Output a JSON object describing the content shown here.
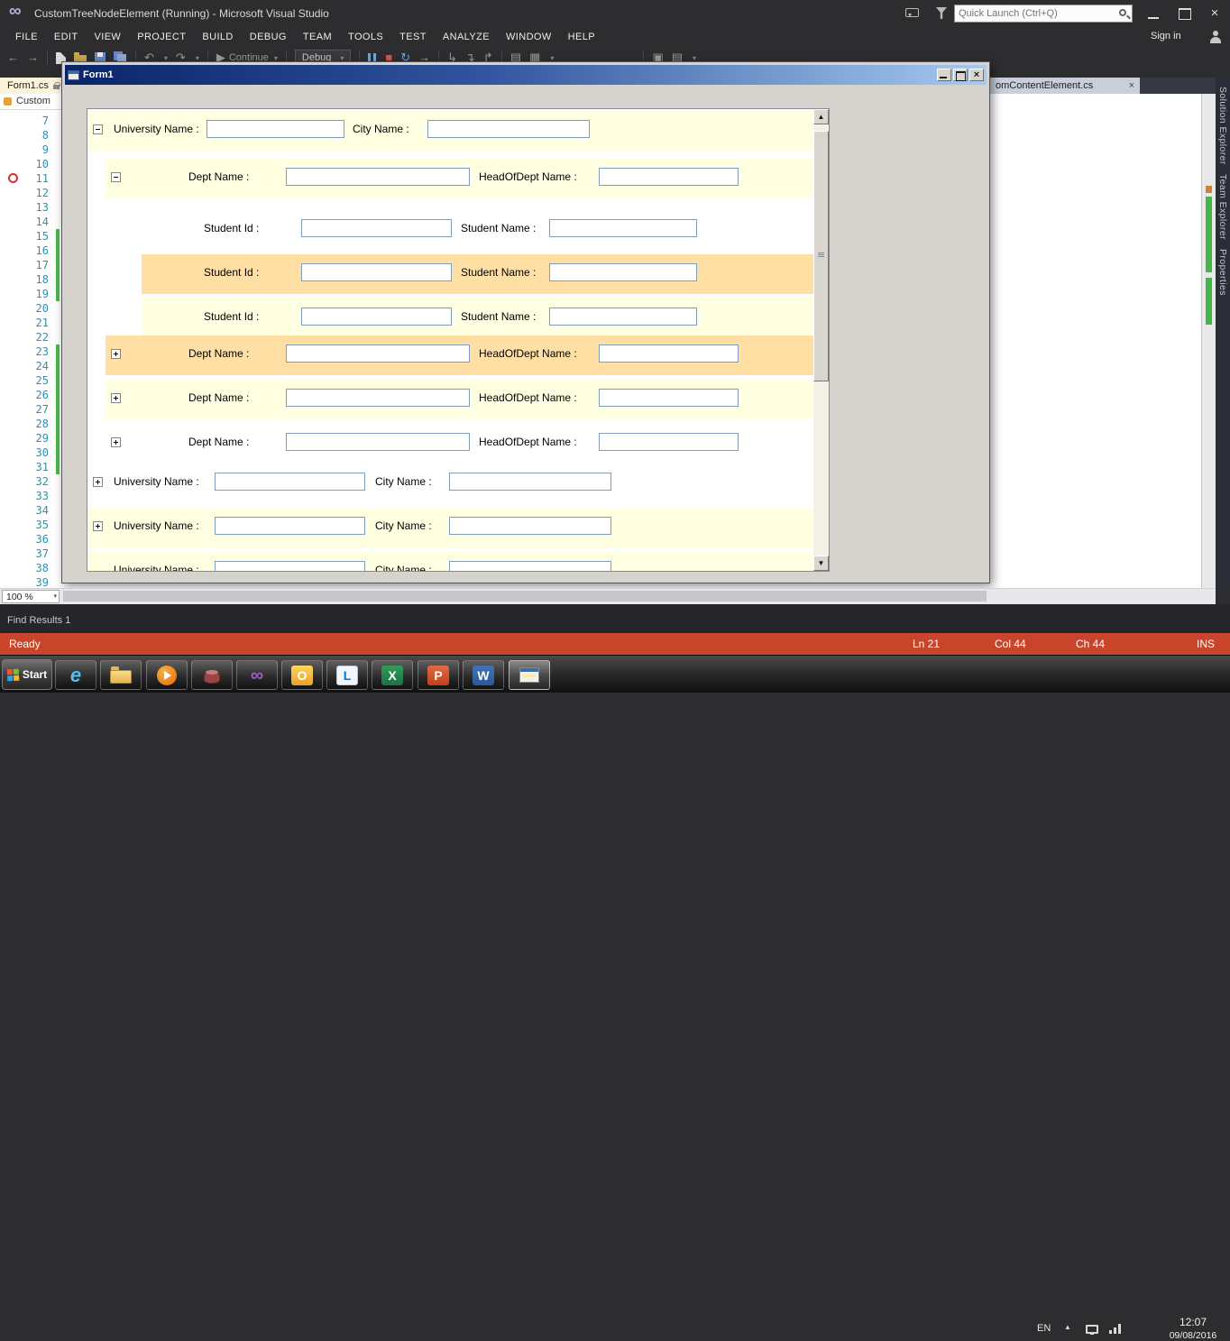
{
  "titlebar": {
    "app_title": "CustomTreeNodeElement (Running) - Microsoft Visual Studio",
    "quick_launch_placeholder": "Quick Launch (Ctrl+Q)"
  },
  "menubar": {
    "items": [
      "FILE",
      "EDIT",
      "VIEW",
      "PROJECT",
      "BUILD",
      "DEBUG",
      "TEAM",
      "TOOLS",
      "TEST",
      "ANALYZE",
      "WINDOW",
      "HELP"
    ],
    "sign_in_label": "Sign in"
  },
  "toolbar": {
    "continue_label": "Continue",
    "debug_label": "Debug"
  },
  "tabs": {
    "active_doc": "Form1.cs",
    "other_doc": "omContentElement.cs",
    "navbar_text": "Custom"
  },
  "editor": {
    "line_numbers": [
      "7",
      "8",
      "9",
      "10",
      "11",
      "12",
      "13",
      "14",
      "15",
      "16",
      "17",
      "18",
      "19",
      "20",
      "21",
      "22",
      "23",
      "24",
      "25",
      "26",
      "27",
      "28",
      "29",
      "30",
      "31",
      "32",
      "33",
      "34",
      "35",
      "36",
      "37",
      "38",
      "39"
    ],
    "zoom_value": "100 %",
    "breakpoint_line": "11"
  },
  "side_tabs": [
    "Solution Explorer",
    "Team Explorer",
    "Properties"
  ],
  "form1": {
    "window_title": "Form1",
    "labels": {
      "university": "University Name :",
      "city": "City Name :",
      "dept": "Dept Name :",
      "head": "HeadOfDept  Name :",
      "student_id": "Student Id :",
      "student_name": "Student Name :"
    },
    "rows": [
      {
        "kind": "university",
        "expander": "minus",
        "highlight": "yellow"
      },
      {
        "kind": "department",
        "expander": "minus",
        "highlight": "yellow"
      },
      {
        "kind": "student",
        "expander": "none",
        "highlight": "white"
      },
      {
        "kind": "student",
        "expander": "none",
        "highlight": "orange"
      },
      {
        "kind": "student",
        "expander": "none",
        "highlight": "yellow"
      },
      {
        "kind": "department",
        "expander": "plus",
        "highlight": "orange"
      },
      {
        "kind": "department",
        "expander": "plus",
        "highlight": "yellow"
      },
      {
        "kind": "department",
        "expander": "plus",
        "highlight": "white"
      },
      {
        "kind": "university",
        "expander": "plus",
        "highlight": "white"
      },
      {
        "kind": "university",
        "expander": "plus",
        "highlight": "yellow"
      },
      {
        "kind": "university",
        "expander": "none",
        "highlight": "yellow"
      }
    ],
    "inputs_empty_value": ""
  },
  "bottom_panel": {
    "find_results_label": "Find Results 1"
  },
  "statusbar": {
    "state": "Ready",
    "line": "Ln 21",
    "column": "Col 44",
    "character": "Ch 44",
    "mode": "INS"
  },
  "taskbar": {
    "start_label": "Start",
    "app_icons": [
      "internet-explorer",
      "file-explorer",
      "media-player",
      "sql-server",
      "visual-studio",
      "outlook",
      "lync",
      "excel",
      "powerpoint",
      "word",
      "form1-app"
    ],
    "letters": {
      "outlook": "O",
      "lync": "L",
      "excel": "X",
      "powerpoint": "P",
      "word": "W"
    },
    "tray": {
      "language": "EN",
      "time": "12:07",
      "date": "09/08/2016"
    }
  },
  "colors": {
    "statusbar_running": "#C8452C",
    "row_yellow": "#FFFFE1",
    "row_orange": "#FFDFA3",
    "form_titlebar": "#0A246A",
    "line_number": "#2B91AF",
    "change_bar": "#49B94B"
  },
  "glyphs": {
    "infinity": "∞",
    "close": "×",
    "caret": "▾",
    "up": "▲",
    "down": "▼",
    "back": "←",
    "forward": "→",
    "undo": "↶",
    "redo": "↷",
    "play": "▶",
    "stop": "■",
    "restart": "↻",
    "next_statement": "→",
    "step_into": "↳",
    "step_over": "↴",
    "step_out": "↱",
    "ie": "e",
    "misc1": "▤",
    "misc2": "▦",
    "misc3": "▣"
  }
}
